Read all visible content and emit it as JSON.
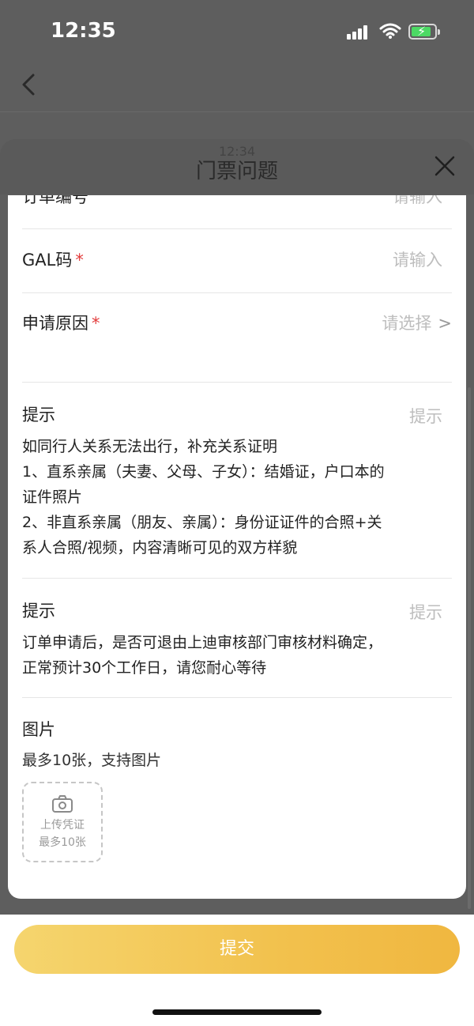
{
  "status_bar": {
    "time": "12:35"
  },
  "sheet": {
    "ghost_time": "12:34",
    "title": "门票问题"
  },
  "form": {
    "order_no": {
      "label": "订单编号",
      "placeholder": "请输入"
    },
    "gal_code": {
      "label": "GAL码",
      "required_mark": "*",
      "placeholder": "请输入"
    },
    "reason": {
      "label": "申请原因",
      "required_mark": "*",
      "placeholder": "请选择",
      "chevron": ">"
    },
    "tip1": {
      "label": "提示",
      "placeholder": "提示",
      "lines": [
        "如同行人关系无法出行，补充关系证明",
        "1、直系亲属（夫妻、父母、子女）：结婚证，户口本的",
        "证件照片",
        "2、非直系亲属（朋友、亲属）：身份证证件的合照+关",
        "系人合照/视频，内容清晰可见的双方样貌"
      ]
    },
    "tip2": {
      "label": "提示",
      "placeholder": "提示",
      "lines": [
        "订单申请后，是否可退由上迪审核部门审核材料确定，",
        "正常预计30个工作日，请您耐心等待"
      ]
    },
    "images": {
      "label": "图片",
      "subtitle": "最多10张，支持图片",
      "upload_line1": "上传凭证",
      "upload_line2": "最多10张"
    }
  },
  "submit": {
    "label": "提交"
  },
  "colors": {
    "accent": "#f2c14d",
    "required": "#e23b3b",
    "placeholder": "#bdbdbd"
  },
  "icons": [
    "back-icon",
    "close-icon",
    "camera-icon",
    "wifi-icon",
    "signal-icon",
    "battery-icon"
  ]
}
